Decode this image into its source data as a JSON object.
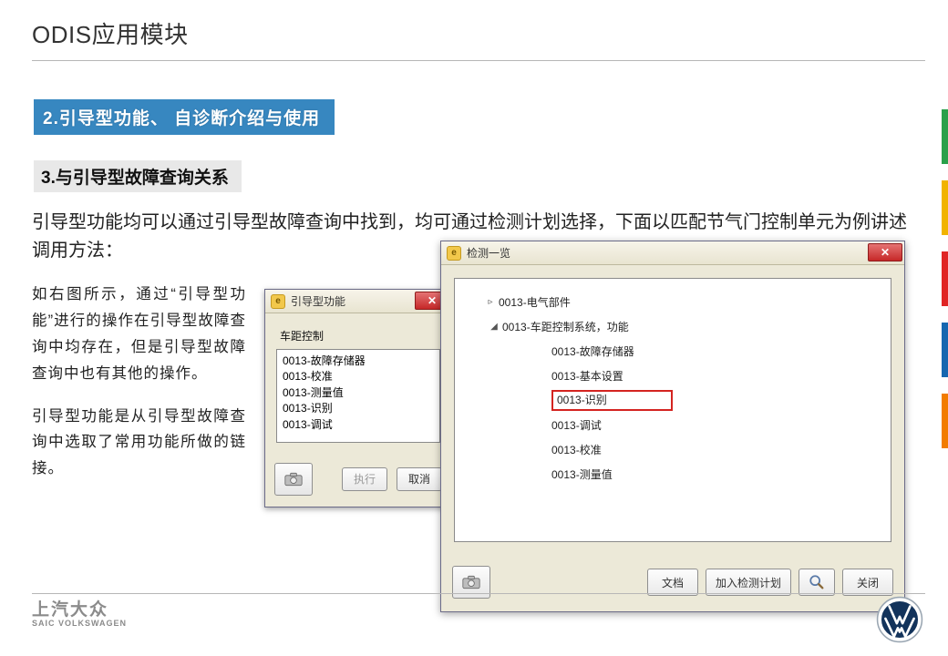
{
  "title": "ODIS应用模块",
  "h2": "2.引导型功能、 自诊断介绍与使用",
  "h3": "3.与引导型故障查询关系",
  "intro": "引导型功能均可以通过引导型故障查询中找到，均可通过检测计划选择，下面以匹配节气门控制单元为例讲述调用方法：",
  "leftParas": [
    "如右图所示，通过“引导型功能”进行的操作在引导型故障查询中均存在，但是引导型故障查询中也有其他的操作。",
    "引导型功能是从引导型故障查询中选取了常用功能所做的链接。"
  ],
  "smallDlg": {
    "title": "引导型功能",
    "group": "车距控制",
    "items": [
      "0013-故障存储器",
      "0013-校准",
      "0013-测量值",
      "0013-识别",
      "0013-调试"
    ],
    "exec": "执行",
    "cancel": "取消"
  },
  "bigDlg": {
    "title": "检测一览",
    "tree": [
      {
        "level": 1,
        "exp": "▹",
        "label": "0013-电气部件"
      },
      {
        "level": 2,
        "exp": "◢",
        "label": "0013-车距控制系统，功能"
      },
      {
        "level": 3,
        "exp": "",
        "label": "0013-故障存储器"
      },
      {
        "level": 3,
        "exp": "",
        "label": "0013-基本设置"
      },
      {
        "level": 3,
        "exp": "",
        "label": "0013-识别",
        "highlight": true
      },
      {
        "level": 3,
        "exp": "",
        "label": "0013-调试"
      },
      {
        "level": 3,
        "exp": "",
        "label": "0013-校准"
      },
      {
        "level": 3,
        "exp": "",
        "label": "0013-测量值"
      }
    ],
    "btnDoc": "文档",
    "btnAdd": "加入检测计划",
    "btnClose": "关闭"
  },
  "brand": {
    "cn": "上汽大众",
    "en": "SAIC VOLKSWAGEN"
  },
  "sideColors": [
    "#2aa04a",
    "#f1b300",
    "#e02424",
    "#1667b0",
    "#f27c00"
  ]
}
